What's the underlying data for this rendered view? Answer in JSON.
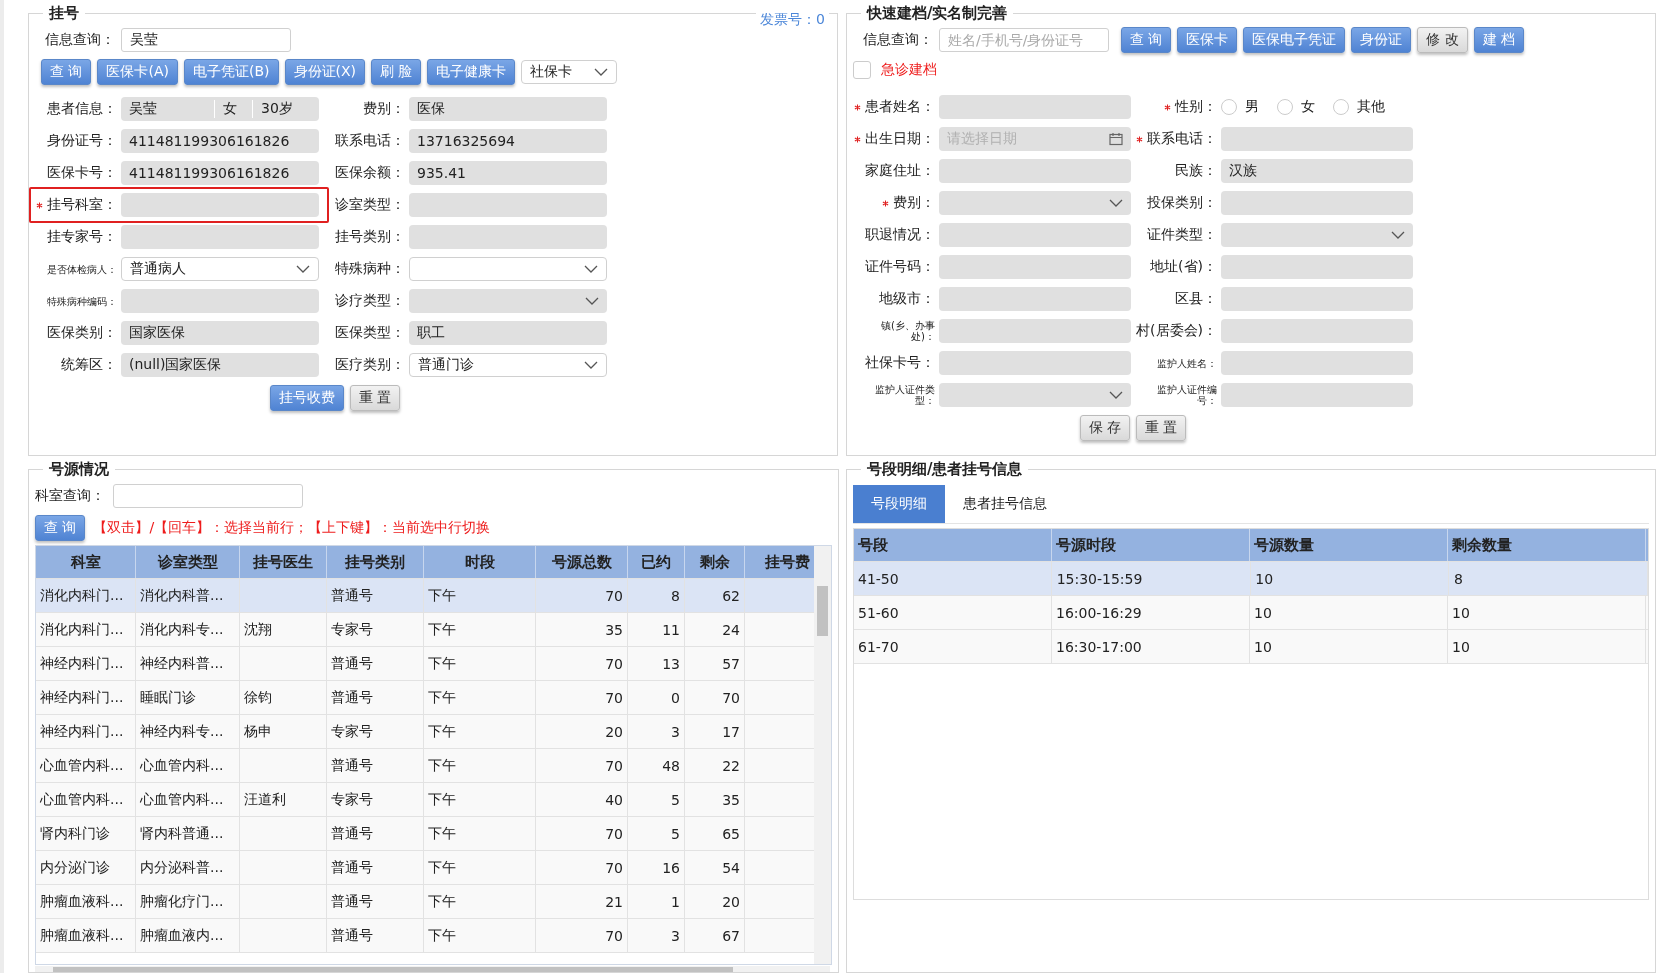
{
  "registration": {
    "title": "挂号",
    "invoice_label": "发票号：",
    "invoice_value": "0",
    "query": {
      "label": "信息查询：",
      "value": "吴莹"
    },
    "buttons": [
      {
        "label": "查 询"
      },
      {
        "label": "医保卡(A)"
      },
      {
        "label": "电子凭证(B)"
      },
      {
        "label": "身份证(X)"
      },
      {
        "label": "刷 脸"
      },
      {
        "label": "电子健康卡"
      }
    ],
    "card_select": {
      "value": "社保卡"
    },
    "fields": [
      {
        "label": "患者信息：",
        "kind": "multi",
        "parts": [
          "吴莹",
          "女",
          "30岁"
        ],
        "disabled": true,
        "required": false,
        "compact": false
      },
      {
        "label": "费别：",
        "kind": "text",
        "value": "医保",
        "disabled": true,
        "required": false,
        "compact": false
      },
      {
        "label": "身份证号：",
        "kind": "text",
        "value": "411481199306161826",
        "disabled": true,
        "required": false,
        "compact": false
      },
      {
        "label": "联系电话：",
        "kind": "text",
        "value": "13716325694",
        "disabled": true,
        "required": false,
        "compact": false
      },
      {
        "label": "医保卡号：",
        "kind": "text",
        "value": "411481199306161826",
        "disabled": true,
        "required": false,
        "compact": false
      },
      {
        "label": "医保余额：",
        "kind": "text",
        "value": "935.41",
        "disabled": true,
        "required": false,
        "compact": false
      },
      {
        "label": "挂号科室：",
        "kind": "text",
        "disabled": true,
        "required": true,
        "compact": false,
        "highlighted": true
      },
      {
        "label": "诊室类型：",
        "kind": "text",
        "disabled": true,
        "required": false,
        "compact": false
      },
      {
        "label": "挂专家号：",
        "kind": "text",
        "disabled": true,
        "required": false,
        "compact": false
      },
      {
        "label": "挂号类别：",
        "kind": "text",
        "disabled": true,
        "required": false,
        "compact": false
      },
      {
        "label": "是否体检病人：",
        "kind": "select",
        "value": "普通病人",
        "disabled": false,
        "required": false,
        "compact": true
      },
      {
        "label": "特殊病种：",
        "kind": "select",
        "disabled": false,
        "required": false,
        "compact": false
      },
      {
        "label": "特殊病种编码：",
        "kind": "text",
        "disabled": true,
        "required": false,
        "compact": true
      },
      {
        "label": "诊疗类型：",
        "kind": "select",
        "disabled": true,
        "required": false,
        "compact": false
      },
      {
        "label": "医保类别：",
        "kind": "text",
        "value": "国家医保",
        "disabled": true,
        "required": false,
        "compact": false
      },
      {
        "label": "医保类型：",
        "kind": "text",
        "value": "职工",
        "disabled": true,
        "required": false,
        "compact": false
      },
      {
        "label": "统筹区：",
        "kind": "text",
        "value": "(null)国家医保",
        "disabled": true,
        "required": false,
        "compact": false
      },
      {
        "label": "医疗类别：",
        "kind": "select",
        "value": "普通门诊",
        "disabled": false,
        "required": false,
        "compact": false
      }
    ],
    "actions": [
      {
        "label": "挂号收费",
        "primary": true
      },
      {
        "label": "重 置",
        "primary": false
      }
    ]
  },
  "quick_file": {
    "title": "快速建档/实名制完善",
    "query": {
      "label": "信息查询：",
      "placeholder": "姓名/手机号/身份证号"
    },
    "buttons": [
      {
        "label": "查 询",
        "primary": true
      },
      {
        "label": "医保卡",
        "primary": true
      },
      {
        "label": "医保电子凭证",
        "primary": true
      },
      {
        "label": "身份证",
        "primary": true
      },
      {
        "label": "修 改",
        "primary": false
      },
      {
        "label": "建 档",
        "primary": true
      }
    ],
    "emergency": {
      "label": "急诊建档",
      "checked": false
    },
    "fields": [
      {
        "label": "患者姓名：",
        "kind": "text",
        "disabled": true,
        "required": true,
        "compact": false
      },
      {
        "label": "性别：",
        "kind": "radio",
        "options": [
          {
            "label": "男",
            "selected": false
          },
          {
            "label": "女",
            "selected": false
          },
          {
            "label": "其他",
            "selected": false
          }
        ],
        "required": true,
        "compact": false
      },
      {
        "label": "出生日期：",
        "kind": "date",
        "placeholder": "请选择日期",
        "disabled": true,
        "required": true,
        "compact": false
      },
      {
        "label": "联系电话：",
        "kind": "text",
        "disabled": true,
        "required": true,
        "compact": false
      },
      {
        "label": "家庭住址：",
        "kind": "text",
        "disabled": true,
        "required": false,
        "compact": false
      },
      {
        "label": "民族：",
        "kind": "text",
        "value": "汉族",
        "disabled": true,
        "required": false,
        "compact": false
      },
      {
        "label": "费别：",
        "kind": "select",
        "disabled": true,
        "required": true,
        "compact": false
      },
      {
        "label": "投保类别：",
        "kind": "text",
        "disabled": true,
        "required": false,
        "compact": false
      },
      {
        "label": "职退情况：",
        "kind": "text",
        "disabled": true,
        "required": false,
        "compact": false
      },
      {
        "label": "证件类型：",
        "kind": "select",
        "disabled": true,
        "required": false,
        "compact": false
      },
      {
        "label": "证件号码：",
        "kind": "text",
        "disabled": true,
        "required": false,
        "compact": false
      },
      {
        "label": "地址(省)：",
        "kind": "text",
        "disabled": true,
        "required": false,
        "compact": false
      },
      {
        "label": "地级市：",
        "kind": "text",
        "disabled": true,
        "required": false,
        "compact": false
      },
      {
        "label": "区县：",
        "kind": "text",
        "disabled": true,
        "required": false,
        "compact": false
      },
      {
        "label": "镇(乡、办事处)：",
        "kind": "text",
        "disabled": true,
        "required": false,
        "compact": true
      },
      {
        "label": "村(居委会)：",
        "kind": "text",
        "disabled": true,
        "required": false,
        "compact": false
      },
      {
        "label": "社保卡号：",
        "kind": "text",
        "disabled": true,
        "required": false,
        "compact": false
      },
      {
        "label": "监护人姓名：",
        "kind": "text",
        "disabled": true,
        "required": false,
        "compact": true
      },
      {
        "label": "监护人证件类型：",
        "kind": "select",
        "disabled": true,
        "required": false,
        "compact": true
      },
      {
        "label": "监护人证件编号：",
        "kind": "text",
        "disabled": true,
        "required": false,
        "compact": true
      }
    ],
    "actions": [
      {
        "label": "保 存"
      },
      {
        "label": "重 置"
      }
    ]
  },
  "sources": {
    "title": "号源情况",
    "query": {
      "label": "科室查询："
    },
    "query_button": "查 询",
    "hint": "【双击】/【回车】：选择当前行；【上下键】：当前选中行切换",
    "columns": [
      {
        "label": "科室",
        "numeric": false
      },
      {
        "label": "诊室类型",
        "numeric": false
      },
      {
        "label": "挂号医生",
        "numeric": false
      },
      {
        "label": "挂号类别",
        "numeric": false
      },
      {
        "label": "时段",
        "numeric": false
      },
      {
        "label": "号源总数",
        "numeric": true
      },
      {
        "label": "已约",
        "numeric": true
      },
      {
        "label": "剩余",
        "numeric": true
      },
      {
        "label": "挂号费"
      }
    ],
    "rows": [
      {
        "selected": true,
        "cells": [
          "消化内科门...",
          "消化内科普...",
          "",
          "普通号",
          "下午",
          "70",
          "8",
          "62",
          ""
        ]
      },
      {
        "selected": false,
        "cells": [
          "消化内科门...",
          "消化内科专...",
          "沈翔",
          "专家号",
          "下午",
          "35",
          "11",
          "24",
          ""
        ]
      },
      {
        "selected": false,
        "cells": [
          "神经内科门...",
          "神经内科普...",
          "",
          "普通号",
          "下午",
          "70",
          "13",
          "57",
          ""
        ]
      },
      {
        "selected": false,
        "cells": [
          "神经内科门...",
          "睡眠门诊",
          "徐钧",
          "普通号",
          "下午",
          "70",
          "0",
          "70",
          ""
        ]
      },
      {
        "selected": false,
        "cells": [
          "神经内科门...",
          "神经内科专...",
          "杨申",
          "专家号",
          "下午",
          "20",
          "3",
          "17",
          ""
        ]
      },
      {
        "selected": false,
        "cells": [
          "心血管内科...",
          "心血管内科...",
          "",
          "普通号",
          "下午",
          "70",
          "48",
          "22",
          ""
        ]
      },
      {
        "selected": false,
        "cells": [
          "心血管内科...",
          "心血管内科...",
          "汪道利",
          "专家号",
          "下午",
          "40",
          "5",
          "35",
          ""
        ]
      },
      {
        "selected": false,
        "cells": [
          "肾内科门诊",
          "肾内科普通...",
          "",
          "普通号",
          "下午",
          "70",
          "5",
          "65",
          ""
        ]
      },
      {
        "selected": false,
        "cells": [
          "内分泌门诊",
          "内分泌科普...",
          "",
          "普通号",
          "下午",
          "70",
          "16",
          "54",
          ""
        ]
      },
      {
        "selected": false,
        "cells": [
          "肿瘤血液科...",
          "肿瘤化疗门...",
          "",
          "普通号",
          "下午",
          "21",
          "1",
          "20",
          ""
        ]
      },
      {
        "selected": false,
        "cells": [
          "肿瘤血液科...",
          "肿瘤血液内...",
          "",
          "普通号",
          "下午",
          "70",
          "3",
          "67",
          ""
        ]
      }
    ]
  },
  "detail": {
    "title": "号段明细/患者挂号信息",
    "tabs": [
      {
        "label": "号段明细",
        "selected": true
      },
      {
        "label": "患者挂号信息",
        "selected": false
      }
    ],
    "columns": [
      "号段",
      "号源时段",
      "号源数量",
      "剩余数量"
    ],
    "rows": [
      {
        "selected": true,
        "cells": [
          "41-50",
          "15:30-15:59",
          "10",
          "8"
        ]
      },
      {
        "selected": false,
        "cells": [
          "51-60",
          "16:00-16:29",
          "10",
          "10"
        ]
      },
      {
        "selected": false,
        "cells": [
          "61-70",
          "16:30-17:00",
          "10",
          "10"
        ]
      }
    ]
  }
}
